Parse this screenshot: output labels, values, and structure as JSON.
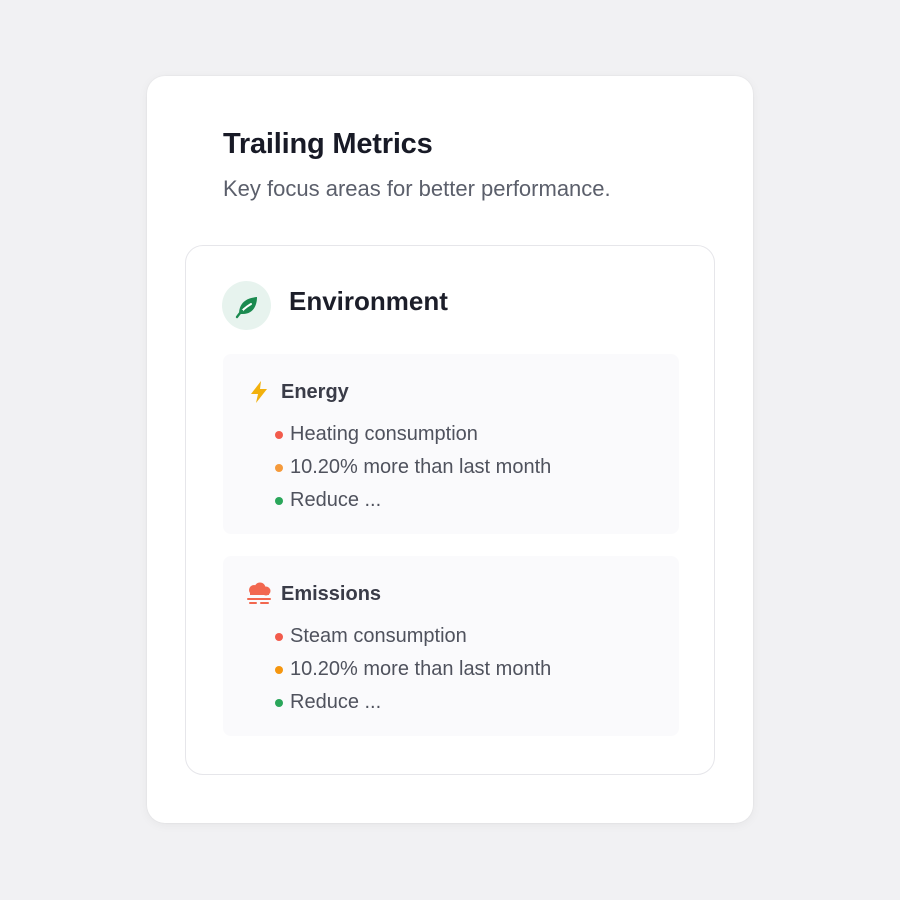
{
  "card": {
    "title": "Trailing Metrics",
    "subtitle": "Key focus areas for better performance."
  },
  "section": {
    "title": "Environment",
    "icon": "leaf-icon",
    "icon_color": "#1a8a4f"
  },
  "metrics": [
    {
      "title": "Energy",
      "icon": "lightning-icon",
      "icon_color": "#f2b10d",
      "items": [
        {
          "text": "Heating consumption",
          "dot_color": "#f25b4c"
        },
        {
          "text": "10.20% more than last month",
          "dot_color": "#f59a3b"
        },
        {
          "text": "Reduce ...",
          "dot_color": "#2aa65a"
        }
      ]
    },
    {
      "title": "Emissions",
      "icon": "factory-smoke-icon",
      "icon_color": "#f2674f",
      "items": [
        {
          "text": "Steam consumption",
          "dot_color": "#f25b4c"
        },
        {
          "text": "10.20% more than last month",
          "dot_color": "#f5960f"
        },
        {
          "text": "Reduce ...",
          "dot_color": "#2aa65a"
        }
      ]
    }
  ]
}
